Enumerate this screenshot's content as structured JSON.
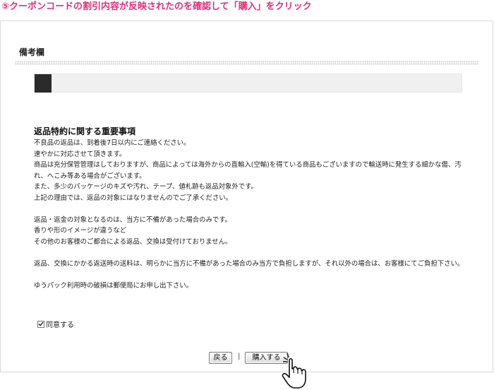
{
  "instruction": "⑤クーポンコードの割引内容が反映されたのを確認して「購入」をクリック",
  "remarks": {
    "title": "備考欄",
    "value": ""
  },
  "policy": {
    "title": "返品特約に関する重要事項",
    "lines": [
      "不良品の返品は、到着後7日以内にご連絡ください。",
      "速やかに対応させて頂きます。",
      "商品は充分保管管理はしておりますが、商品によっては海外からの直輸入(空輸)を得ている商品もございますので輸送時に発生する細かな傷、汚れ、へこみ等ある場合がございます。",
      "また、多少のパッケージのキズや汚れ、テープ、値札跡も返品対象外です。",
      "上記の理由では、返品の対象にはなりませんのでご了承ください。",
      "返品・返金の対象となるのは、当方に不備があった場合のみです。",
      "香りや形のイメージが違うなど",
      "その他のお客様のご都合による返品、交換は受付けておりません。",
      "返品、交換にかかる返送時の送料は、明らかに当方に不備があった場合のみ当方で負担しますが、それ以外の場合は、お客様にてご負担下さい。",
      "ゆうパック利用時の破損は郵便局にお申し出下さい。"
    ]
  },
  "agree": {
    "label": "同意する",
    "checked": true
  },
  "buttons": {
    "back": "戻る",
    "separator": "|",
    "buy": "購入する"
  },
  "icons": {
    "checkmark": "checkmark-icon",
    "hand_cursor": "hand-pointer-icon"
  }
}
